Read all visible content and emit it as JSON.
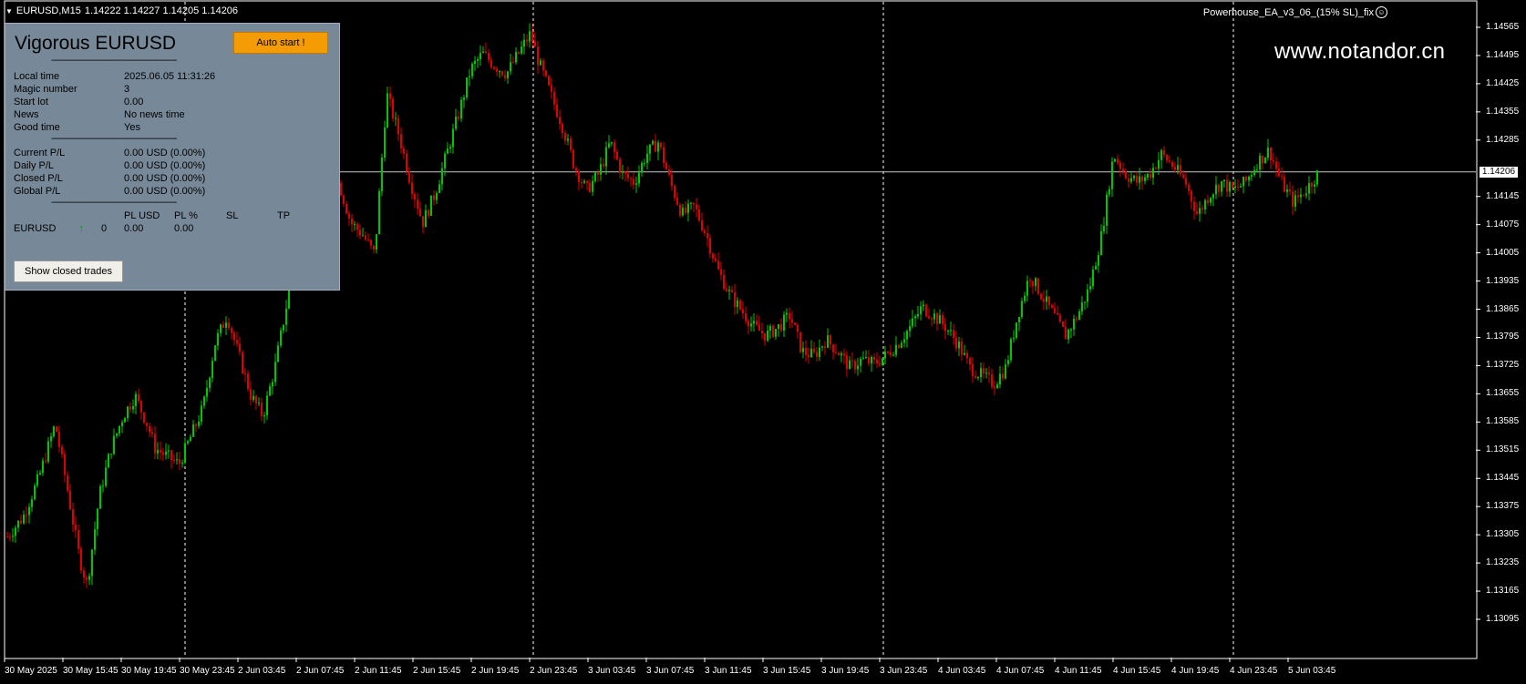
{
  "header": {
    "symbol_tf": "EURUSD,M15",
    "ohlc": "1.14222 1.14227 1.14205 1.14206"
  },
  "ea_label": "Powerhouse_EA_v3_06_(15% SL)_fix",
  "watermark": "www.notandor.cn",
  "panel": {
    "title": "Vigorous EURUSD",
    "auto_button": "Auto start !",
    "separator": "-----------------------------------------------------------",
    "info": [
      {
        "label": "Local time",
        "value": "2025.06.05 11:31:26"
      },
      {
        "label": "Magic number",
        "value": "3"
      },
      {
        "label": "Start lot",
        "value": "0.00"
      },
      {
        "label": "News",
        "value": "No news time"
      },
      {
        "label": "Good time",
        "value": "Yes"
      }
    ],
    "pl": [
      {
        "label": "Current P/L",
        "value": "0.00 USD (0.00%)"
      },
      {
        "label": "Daily P/L",
        "value": "0.00 USD (0.00%)"
      },
      {
        "label": "Closed P/L",
        "value": "0.00 USD (0.00%)"
      },
      {
        "label": "Global P/L",
        "value": "0.00 USD (0.00%)"
      }
    ],
    "columns": {
      "pl_usd": "PL USD",
      "pl_pct": "PL %",
      "sl": "SL",
      "tp": "TP"
    },
    "symbol_row": {
      "symbol": "EURUSD",
      "count": "0",
      "pl_usd": "0.00",
      "pl_pct": "0.00"
    },
    "closed_button": "Show closed trades"
  },
  "current_price": "1.14206",
  "colors": {
    "bull": "#00c800",
    "bear": "#e00000",
    "grid": "#ffffff",
    "panel_bg": "#778899",
    "button": "#f59c05"
  },
  "chart_data": {
    "type": "candlestick",
    "y_ticks": [
      "1.14565",
      "1.14495",
      "1.14425",
      "1.14355",
      "1.14285",
      "1.14145",
      "1.14075",
      "1.14005",
      "1.13935",
      "1.13865",
      "1.13795",
      "1.13725",
      "1.13655",
      "1.13585",
      "1.13515",
      "1.13445",
      "1.13375",
      "1.13305",
      "1.13235",
      "1.13165",
      "1.13095"
    ],
    "ylim": [
      1.13095,
      1.14565
    ],
    "x_ticks": [
      "30 May 2025",
      "30 May 15:45",
      "30 May 19:45",
      "30 May 23:45",
      "2 Jun 03:45",
      "2 Jun 07:45",
      "2 Jun 11:45",
      "2 Jun 15:45",
      "2 Jun 19:45",
      "2 Jun 23:45",
      "3 Jun 03:45",
      "3 Jun 07:45",
      "3 Jun 11:45",
      "3 Jun 15:45",
      "3 Jun 19:45",
      "3 Jun 23:45",
      "4 Jun 03:45",
      "4 Jun 07:45",
      "4 Jun 11:45",
      "4 Jun 15:45",
      "4 Jun 19:45",
      "4 Jun 23:45",
      "5 Jun 03:45"
    ],
    "current_price": 1.14206,
    "price_path": [
      [
        0,
        1.133
      ],
      [
        4,
        1.1335
      ],
      [
        8,
        1.1345
      ],
      [
        12,
        1.1358
      ],
      [
        15,
        1.1342
      ],
      [
        18,
        1.1325
      ],
      [
        20,
        1.1318
      ],
      [
        23,
        1.134
      ],
      [
        26,
        1.1352
      ],
      [
        29,
        1.136
      ],
      [
        32,
        1.1365
      ],
      [
        35,
        1.1358
      ],
      [
        37,
        1.1352
      ],
      [
        40,
        1.135
      ],
      [
        43,
        1.1348
      ],
      [
        46,
        1.1355
      ],
      [
        49,
        1.1362
      ],
      [
        52,
        1.1378
      ],
      [
        55,
        1.1385
      ],
      [
        58,
        1.1375
      ],
      [
        61,
        1.1365
      ],
      [
        64,
        1.136
      ],
      [
        67,
        1.1372
      ],
      [
        70,
        1.1388
      ],
      [
        72,
        1.142
      ],
      [
        74,
        1.144
      ],
      [
        77,
        1.1425
      ],
      [
        80,
        1.1412
      ],
      [
        83,
        1.1418
      ],
      [
        86,
        1.1408
      ],
      [
        89,
        1.1405
      ],
      [
        92,
        1.14
      ],
      [
        95,
        1.144
      ],
      [
        98,
        1.143
      ],
      [
        101,
        1.1418
      ],
      [
        104,
        1.1408
      ],
      [
        107,
        1.1415
      ],
      [
        110,
        1.1425
      ],
      [
        113,
        1.1435
      ],
      [
        116,
        1.1446
      ],
      [
        119,
        1.145
      ],
      [
        122,
        1.1447
      ],
      [
        125,
        1.1445
      ],
      [
        128,
        1.145
      ],
      [
        131,
        1.1455
      ],
      [
        133,
        1.1448
      ],
      [
        136,
        1.144
      ],
      [
        139,
        1.1432
      ],
      [
        142,
        1.1422
      ],
      [
        145,
        1.1416
      ],
      [
        148,
        1.142
      ],
      [
        151,
        1.1428
      ],
      [
        154,
        1.142
      ],
      [
        157,
        1.1418
      ],
      [
        160,
        1.1425
      ],
      [
        163,
        1.1428
      ],
      [
        166,
        1.1418
      ],
      [
        169,
        1.141
      ],
      [
        172,
        1.1412
      ],
      [
        175,
        1.1405
      ],
      [
        178,
        1.1396
      ],
      [
        181,
        1.139
      ],
      [
        184,
        1.1386
      ],
      [
        187,
        1.1382
      ],
      [
        190,
        1.138
      ],
      [
        193,
        1.1382
      ],
      [
        196,
        1.1385
      ],
      [
        199,
        1.1376
      ],
      [
        202,
        1.1375
      ],
      [
        205,
        1.1379
      ],
      [
        208,
        1.1376
      ],
      [
        211,
        1.1372
      ],
      [
        214,
        1.1374
      ],
      [
        217,
        1.1373
      ],
      [
        220,
        1.1375
      ],
      [
        223,
        1.1378
      ],
      [
        226,
        1.1382
      ],
      [
        229,
        1.1387
      ],
      [
        232,
        1.1385
      ],
      [
        235,
        1.1382
      ],
      [
        238,
        1.1378
      ],
      [
        241,
        1.1372
      ],
      [
        244,
        1.137
      ],
      [
        247,
        1.1368
      ],
      [
        250,
        1.1372
      ],
      [
        253,
        1.1385
      ],
      [
        256,
        1.1395
      ],
      [
        259,
        1.139
      ],
      [
        262,
        1.1385
      ],
      [
        265,
        1.138
      ],
      [
        268,
        1.1385
      ],
      [
        271,
        1.1392
      ],
      [
        274,
        1.1405
      ],
      [
        277,
        1.1425
      ],
      [
        280,
        1.142
      ],
      [
        283,
        1.1418
      ],
      [
        286,
        1.142
      ],
      [
        289,
        1.1425
      ],
      [
        292,
        1.1422
      ],
      [
        295,
        1.1418
      ],
      [
        298,
        1.141
      ],
      [
        301,
        1.1415
      ],
      [
        304,
        1.1418
      ],
      [
        307,
        1.1416
      ],
      [
        310,
        1.1418
      ],
      [
        313,
        1.1423
      ],
      [
        316,
        1.1426
      ],
      [
        319,
        1.1418
      ],
      [
        322,
        1.1413
      ],
      [
        325,
        1.1416
      ],
      [
        328,
        1.142
      ]
    ]
  }
}
